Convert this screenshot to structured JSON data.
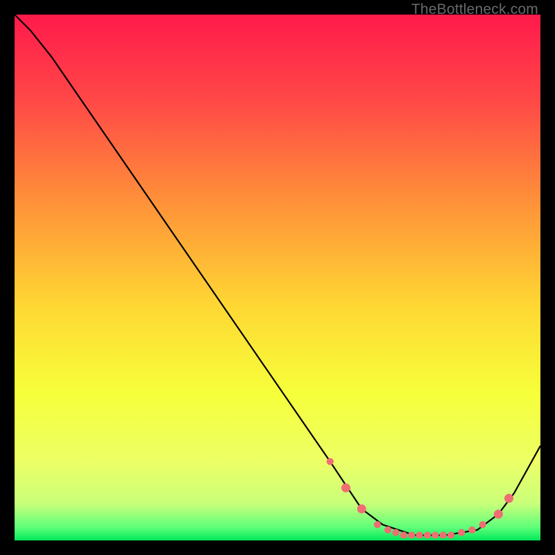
{
  "watermark": "TheBottleneck.com",
  "chart_data": {
    "type": "line",
    "title": "",
    "xlabel": "",
    "ylabel": "",
    "xlim": [
      0,
      100
    ],
    "ylim": [
      0,
      100
    ],
    "grid": false,
    "legend": false,
    "background_gradient_stops": [
      {
        "pos": 0.0,
        "color": "#ff1a4b"
      },
      {
        "pos": 0.16,
        "color": "#ff4747"
      },
      {
        "pos": 0.34,
        "color": "#ff8b3a"
      },
      {
        "pos": 0.55,
        "color": "#ffd633"
      },
      {
        "pos": 0.72,
        "color": "#f6ff3a"
      },
      {
        "pos": 0.85,
        "color": "#ecff66"
      },
      {
        "pos": 0.93,
        "color": "#c9ff7a"
      },
      {
        "pos": 0.975,
        "color": "#5fff7a"
      },
      {
        "pos": 1.0,
        "color": "#00e85a"
      }
    ],
    "series": [
      {
        "name": "bottleneck-curve",
        "stroke": "#000000",
        "x": [
          0,
          3,
          7,
          60,
          66,
          70,
          76,
          82,
          88,
          92,
          95,
          100
        ],
        "y": [
          100,
          97,
          92,
          15,
          6,
          3,
          1,
          1,
          2,
          5,
          9,
          18
        ]
      }
    ],
    "markers": {
      "name": "trough-markers",
      "color": "#ef6e74",
      "radius_small": 5.1,
      "radius_large": 6.5,
      "points": [
        {
          "x": 60,
          "y": 15,
          "r": "small"
        },
        {
          "x": 63,
          "y": 10,
          "r": "large"
        },
        {
          "x": 66,
          "y": 6,
          "r": "large"
        },
        {
          "x": 69,
          "y": 3,
          "r": "small"
        },
        {
          "x": 71,
          "y": 2,
          "r": "small"
        },
        {
          "x": 72.5,
          "y": 1.5,
          "r": "small"
        },
        {
          "x": 74,
          "y": 1,
          "r": "small"
        },
        {
          "x": 75.5,
          "y": 1,
          "r": "small"
        },
        {
          "x": 77,
          "y": 1,
          "r": "small"
        },
        {
          "x": 78.5,
          "y": 1,
          "r": "small"
        },
        {
          "x": 80,
          "y": 1,
          "r": "small"
        },
        {
          "x": 81.5,
          "y": 1,
          "r": "small"
        },
        {
          "x": 83,
          "y": 1,
          "r": "small"
        },
        {
          "x": 85,
          "y": 1.5,
          "r": "small"
        },
        {
          "x": 87,
          "y": 2,
          "r": "small"
        },
        {
          "x": 89,
          "y": 3,
          "r": "small"
        },
        {
          "x": 92,
          "y": 5,
          "r": "large"
        },
        {
          "x": 94,
          "y": 8,
          "r": "large"
        }
      ]
    }
  }
}
